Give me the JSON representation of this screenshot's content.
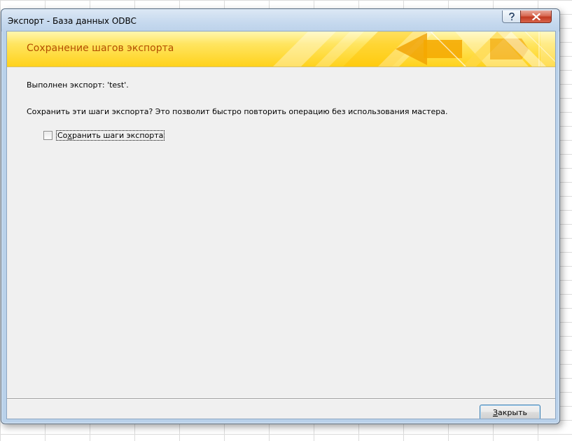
{
  "window": {
    "title": "Экспорт - База данных ODBC",
    "help_icon": "question-mark-icon",
    "close_icon": "close-x-icon"
  },
  "banner": {
    "title": "Сохранение шагов экспорта",
    "accent_color": "#ffd21c",
    "title_color": "#b34e00"
  },
  "content": {
    "export_status": "Выполнен экспорт: 'test'.",
    "save_prompt": "Сохранить эти шаги экспорта? Это позволит быстро повторить операцию без использования мастера.",
    "save_checkbox": {
      "label_pre": "Со",
      "label_accel": "х",
      "label_post": "ранить шаги экспорта",
      "checked": false
    }
  },
  "footer": {
    "close_button": {
      "accel": "З",
      "rest": "акрыть"
    }
  }
}
